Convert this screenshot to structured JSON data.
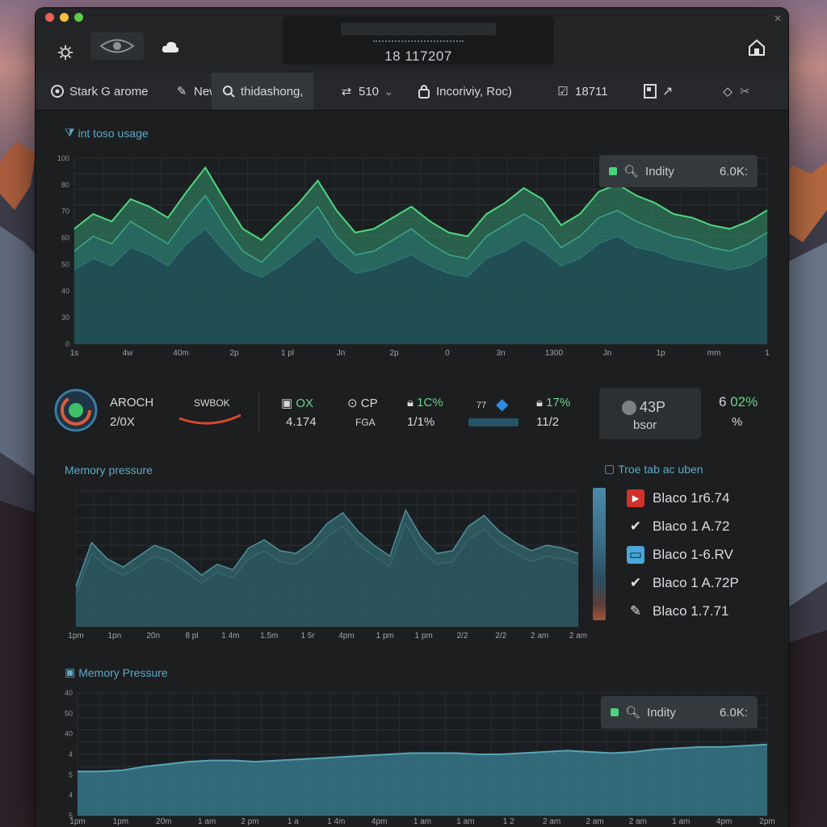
{
  "titlebar": {
    "time": "18 117207"
  },
  "toolbar": {
    "items": [
      {
        "label": "Stark G arome",
        "icon": "clock-icon"
      },
      {
        "label": "New",
        "icon": "edit-icon"
      },
      {
        "label": "thidashong,",
        "icon": "search-icon"
      },
      {
        "label": "510",
        "icon": "shuffle-icon"
      },
      {
        "label": "Incoriviy, Roc)",
        "icon": "lock-icon"
      },
      {
        "label": "18711",
        "icon": "check-icon"
      },
      {
        "label": "",
        "icon": "doc-icon"
      },
      {
        "label": "",
        "icon": "diamond-icon"
      }
    ]
  },
  "cpu_section": {
    "title": "int toso usage",
    "legend": "Indity",
    "legend_value": "6.0K:"
  },
  "stats": {
    "ring_title": "AROCH",
    "ring_value": "2/0X",
    "swap_label": "SWBOK",
    "s1_top": "OX",
    "s1_bot": "4.174",
    "s2_top": "CP",
    "s2_bot": "FGA",
    "s3_top": "1C%",
    "s3_bot": "1/1%",
    "s4_label": "77",
    "s5_top": "17%",
    "s5_bot": "11/2",
    "box_value": "43P",
    "box_label": "bsor",
    "s6_top": "02%",
    "s6_bot": "%"
  },
  "memory_section": {
    "title": "Memory pressure",
    "side_title": "Troe tab ac uben",
    "list": [
      {
        "label": "Blaco 1r6.74",
        "icon": "flag-icon",
        "color": "#d0322b"
      },
      {
        "label": "Blaco 1 A.72",
        "icon": "check-icon",
        "color": "#e4e4e4"
      },
      {
        "label": "Blaco 1-6.RV",
        "icon": "window-icon",
        "color": "#4aa6d8"
      },
      {
        "label": "Blaco 1 A.72P",
        "icon": "check-icon",
        "color": "#e4e4e4"
      },
      {
        "label": "Blaco 1.7.71",
        "icon": "brush-icon",
        "color": "#e4e4e4"
      }
    ]
  },
  "pressure_section": {
    "title": "Memory Pressure",
    "legend": "Indity",
    "legend_value": "6.0K:"
  },
  "chart_data": [
    {
      "type": "area",
      "title": "int toso usage",
      "y_ticks": [
        "100",
        "80",
        "70",
        "60",
        "50",
        "40",
        "30",
        "0"
      ],
      "x_ticks": [
        "1s",
        "4w",
        "40m",
        "2p",
        "1 pl",
        "Jn",
        "2p",
        "0",
        "3n",
        "1300",
        "Jn",
        "1p",
        "mm",
        "1"
      ],
      "series": [
        {
          "values": [
            62,
            70,
            66,
            78,
            74,
            68,
            82,
            95,
            78,
            62,
            56,
            66,
            76,
            88,
            72,
            60,
            62,
            68,
            74,
            66,
            60,
            58,
            70,
            76,
            84,
            78,
            64,
            70,
            82,
            86,
            80,
            76,
            70,
            68,
            64,
            62,
            66,
            72
          ]
        },
        {
          "values": [
            50,
            58,
            54,
            66,
            60,
            54,
            68,
            80,
            64,
            50,
            44,
            54,
            64,
            74,
            58,
            48,
            50,
            56,
            62,
            54,
            48,
            46,
            58,
            64,
            70,
            64,
            52,
            58,
            68,
            72,
            66,
            62,
            58,
            56,
            52,
            50,
            54,
            60
          ]
        },
        {
          "values": [
            40,
            46,
            42,
            52,
            48,
            42,
            54,
            62,
            50,
            40,
            36,
            42,
            50,
            58,
            46,
            38,
            40,
            44,
            48,
            42,
            38,
            36,
            46,
            50,
            56,
            50,
            42,
            46,
            54,
            58,
            52,
            50,
            46,
            44,
            42,
            40,
            42,
            48
          ]
        }
      ],
      "ylim": [
        0,
        100
      ]
    },
    {
      "type": "area",
      "title": "Memory pressure",
      "x_ticks": [
        "1pm",
        "1pn",
        "20n",
        "8 pl",
        "1 4m",
        "1.5m",
        "1 5r",
        "4pm",
        "1 pm",
        "1 pm",
        "2/2",
        "2/2",
        "2 am",
        "2 am"
      ],
      "series": [
        {
          "values": [
            30,
            62,
            50,
            44,
            52,
            60,
            56,
            48,
            38,
            46,
            42,
            58,
            64,
            56,
            54,
            62,
            76,
            84,
            70,
            60,
            52,
            86,
            66,
            54,
            56,
            74,
            82,
            70,
            62,
            56,
            60,
            58,
            54
          ]
        },
        {
          "values": [
            24,
            54,
            44,
            38,
            44,
            52,
            48,
            40,
            32,
            40,
            36,
            50,
            56,
            48,
            46,
            54,
            66,
            74,
            60,
            52,
            44,
            76,
            56,
            46,
            48,
            64,
            72,
            60,
            54,
            48,
            52,
            50,
            46
          ]
        }
      ],
      "ylim": [
        0,
        100
      ]
    },
    {
      "type": "area",
      "title": "Memory Pressure",
      "y_ticks": [
        "40",
        "50",
        "40",
        "4",
        "5",
        "4",
        "5"
      ],
      "x_ticks": [
        "1pm",
        "1pm",
        "20m",
        "1 am",
        "2 pm",
        "1 a",
        "1 4m",
        "4pm",
        "1 am",
        "1 am",
        "1 2",
        "2 am",
        "2 am",
        "2 am",
        "1 am",
        "4pm",
        "2pm"
      ],
      "series": [
        {
          "values": [
            36,
            36,
            37,
            40,
            42,
            44,
            45,
            45,
            44,
            45,
            46,
            47,
            48,
            49,
            50,
            51,
            51,
            51,
            50,
            50,
            51,
            52,
            53,
            52,
            51,
            52,
            54,
            55,
            56,
            56,
            57,
            58
          ]
        }
      ],
      "ylim": [
        0,
        100
      ]
    }
  ]
}
